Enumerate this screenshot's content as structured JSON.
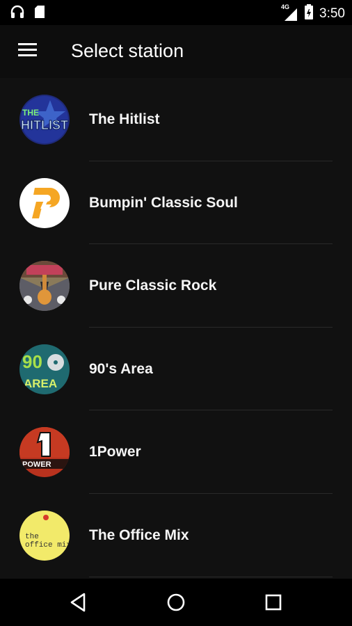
{
  "status_bar": {
    "time": "3:50",
    "network": "4G",
    "icons": [
      "headphones-icon",
      "sd-card-icon",
      "signal-icon",
      "battery-icon"
    ]
  },
  "app_bar": {
    "title": "Select station",
    "menu_icon": "menu-icon"
  },
  "stations": [
    {
      "name": "The Hitlist",
      "logo_text": "THE HITLIST"
    },
    {
      "name": "Bumpin' Classic Soul",
      "logo_text": "P"
    },
    {
      "name": "Pure Classic Rock",
      "logo_text": ""
    },
    {
      "name": "90's Area",
      "logo_text": "90 AREA"
    },
    {
      "name": "1Power",
      "logo_text": "1 POWER"
    },
    {
      "name": "The Office Mix",
      "logo_text": "the office mix"
    }
  ],
  "nav_bar": {
    "icons": [
      "back-icon",
      "home-icon",
      "recents-icon"
    ]
  },
  "colors": {
    "background": "#111111",
    "status_bar": "#000000",
    "divider": "#2a2a2a"
  }
}
